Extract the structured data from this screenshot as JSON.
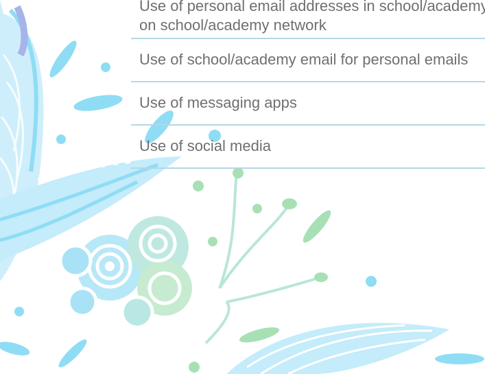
{
  "table": {
    "rows": [
      {
        "line1": "Use of personal email addresses in school/academy, or",
        "line2": "on school/academy network"
      },
      {
        "line1": "Use of school/academy email for personal emails"
      },
      {
        "line1": "Use of messaging apps"
      },
      {
        "line1": "Use of social media"
      }
    ]
  },
  "colors": {
    "row_border": "#b5d6e6",
    "text": "#6f6f6f",
    "decor_blue": "#8fdcf5",
    "decor_green": "#a8e0b5",
    "decor_lavender": "#a6b4ea"
  }
}
